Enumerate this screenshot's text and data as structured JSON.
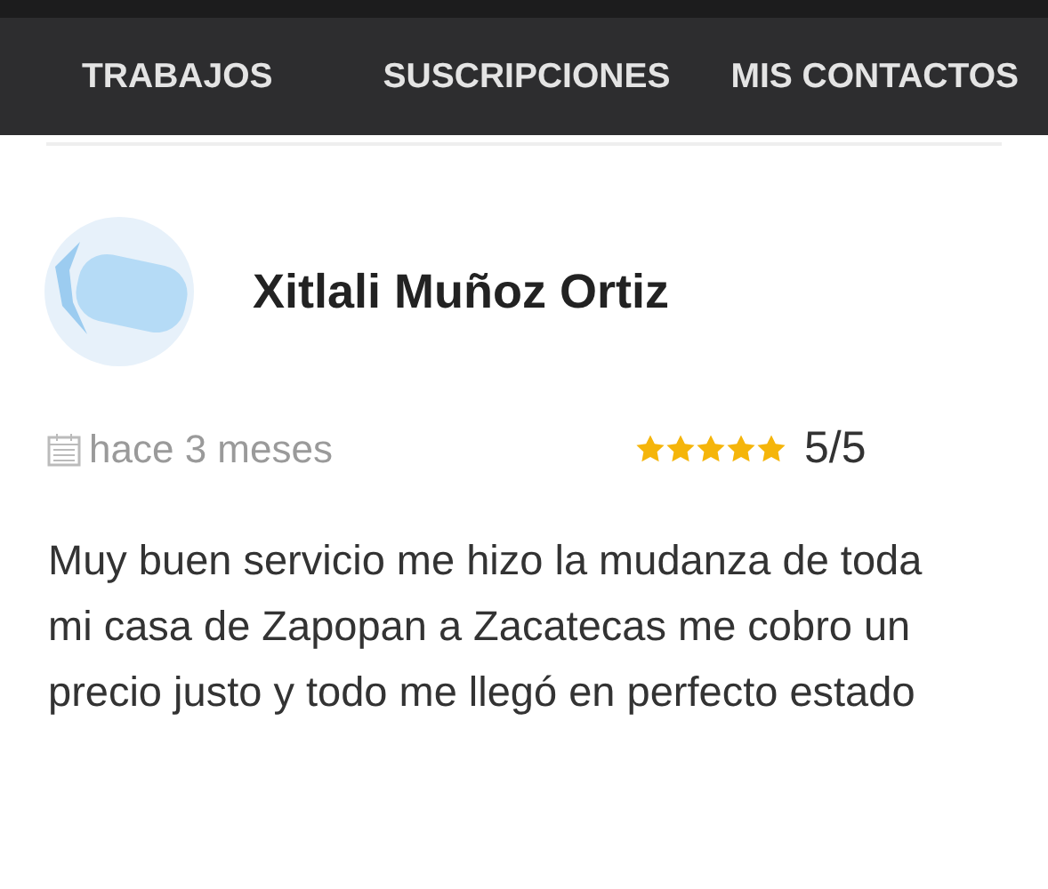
{
  "nav": {
    "tabs": [
      {
        "label": "TRABAJOS"
      },
      {
        "label": "SUSCRIPCIONES"
      },
      {
        "label": "MIS CONTACTOS"
      }
    ]
  },
  "review": {
    "author": "Xitlali Muñoz Ortiz",
    "date": "hace 3 meses",
    "stars": 5,
    "score": "5/5",
    "text": "Muy buen servicio me hizo la mudanza de toda mi casa de Zapopan a Zacatecas me cobro un precio justo y todo me llegó en perfecto estado"
  }
}
